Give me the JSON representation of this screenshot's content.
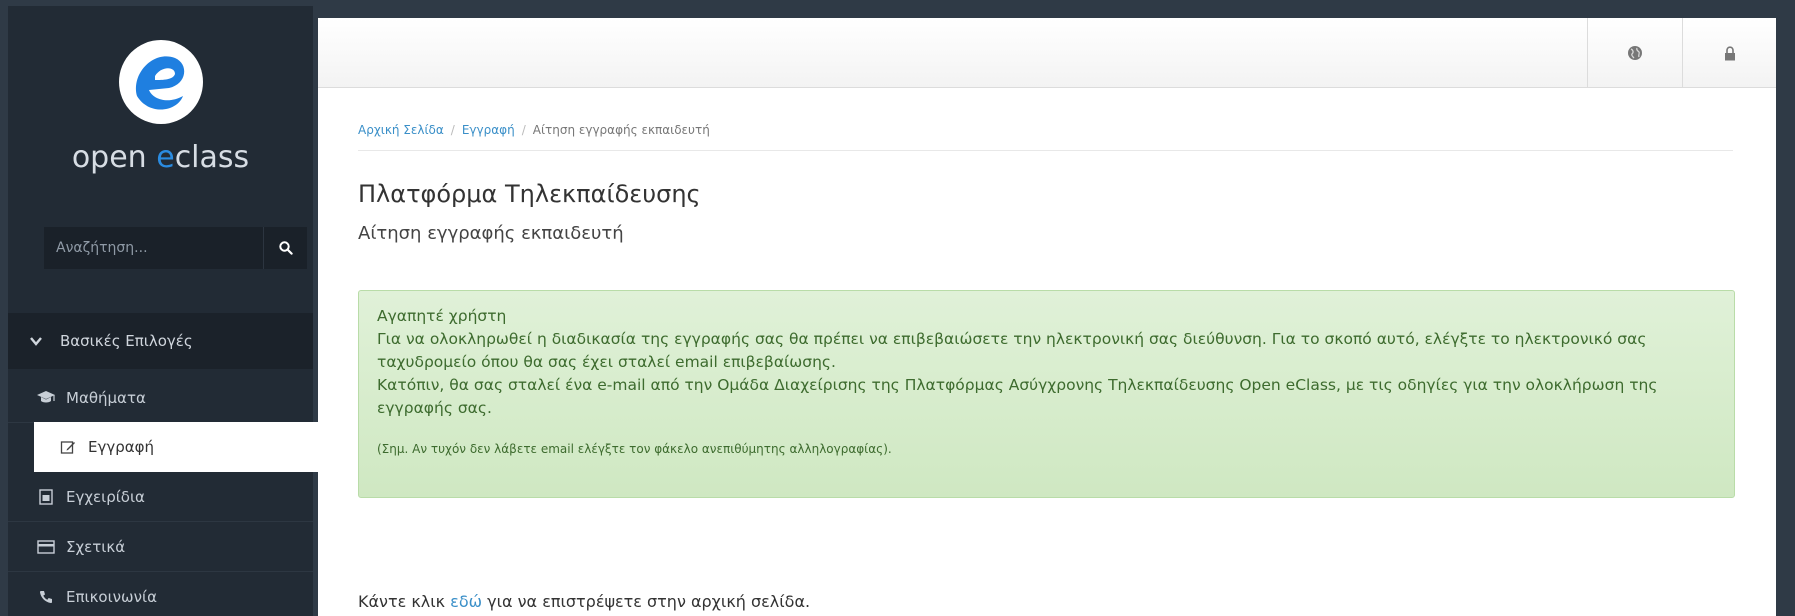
{
  "brand": {
    "text_prefix": "open ",
    "text_accent": "e",
    "text_suffix": "class",
    "accent_color": "#2a8be0"
  },
  "search": {
    "placeholder": "Αναζήτηση..."
  },
  "sidebar": {
    "section_title": "Βασικές Επιλογές",
    "items": [
      {
        "label": "Μαθήματα",
        "icon": "graduation-cap-icon",
        "active": false
      },
      {
        "label": "Εγγραφή",
        "icon": "edit-icon",
        "active": true
      },
      {
        "label": "Εγχειρίδια",
        "icon": "file-icon",
        "active": false
      },
      {
        "label": "Σχετικά",
        "icon": "credit-card-icon",
        "active": false
      },
      {
        "label": "Επικοινωνία",
        "icon": "phone-icon",
        "active": false
      }
    ]
  },
  "topbar": {
    "icons": [
      "globe-icon",
      "lock-icon"
    ]
  },
  "breadcrumb": {
    "home": "Αρχική Σελίδα",
    "registration": "Εγγραφή",
    "current": "Αίτηση εγγραφής εκπαιδευτή",
    "separator": "/"
  },
  "page": {
    "title": "Πλατφόρμα Τηλεκπαίδευσης",
    "subtitle": "Αίτηση εγγραφής εκπαιδευτή"
  },
  "alert": {
    "greeting": "Αγαπητέ χρήστη",
    "line1": "Για να ολοκληρωθεί η διαδικασία της εγγραφής σας θα πρέπει να επιβεβαιώσετε την ηλεκτρονική σας διεύθυνση. Για το σκοπό αυτό, ελέγξτε το ηλεκτρονικό σας ταχυδρομείο όπου θα σας έχει σταλεί email επιβεβαίωσης.",
    "line2": "Κατόπιν, θα σας σταλεί ένα e-mail από την Ομάδα Διαχείρισης της Πλατφόρμας Ασύγχρονης Τηλεκπαίδευσης Open eClass, με τις οδηγίες για την ολοκλήρωση της εγγραφής σας.",
    "note": "(Σημ. Αν τυχόν δεν λάβετε email ελέγξτε τον φάκελο ανεπιθύμητης αλληλογραφίας)."
  },
  "footer": {
    "before": "Κάντε κλικ ",
    "link": "εδώ",
    "after": " για να επιστρέψετε στην αρχική σελίδα."
  }
}
